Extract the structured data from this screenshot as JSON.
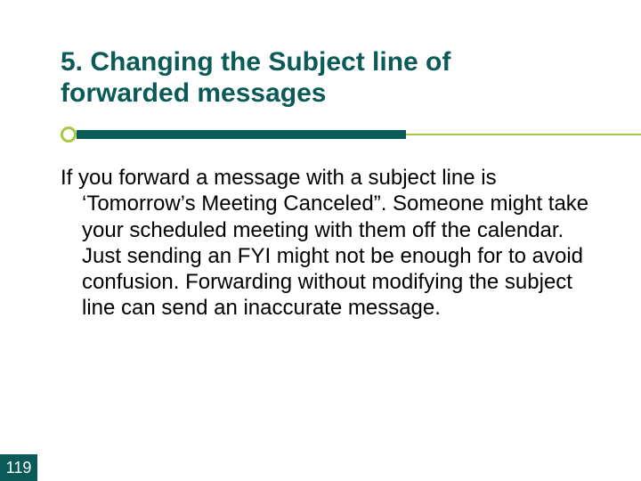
{
  "slide": {
    "title": "5. Changing the Subject line of forwarded messages",
    "body": "If you forward a message with a subject line is ‘Tomorrow’s Meeting Canceled”. Someone might take your scheduled meeting with them off the calendar. Just sending an FYI might not be enough for to avoid confusion. Forwarding without modifying the subject line can send an inaccurate message.",
    "page_number": "119"
  },
  "colors": {
    "accent_dark": "#0a5a58",
    "accent_light": "#a7c843"
  }
}
